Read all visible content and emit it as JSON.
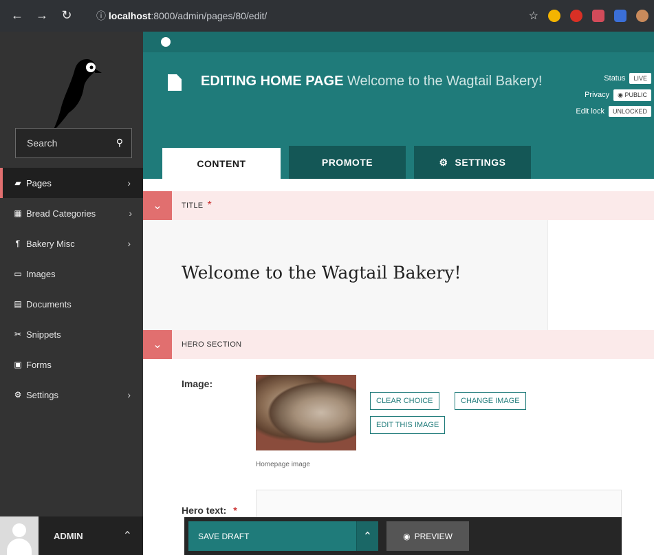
{
  "browser": {
    "url_host": "localhost",
    "url_path": ":8000/admin/pages/80/edit/"
  },
  "sidebar": {
    "search_placeholder": "Search",
    "items": [
      {
        "label": "Pages",
        "icon": "folder-icon",
        "has_submenu": true,
        "active": true
      },
      {
        "label": "Bread Categories",
        "icon": "briefcase-icon",
        "has_submenu": true
      },
      {
        "label": "Bakery Misc",
        "icon": "utensils-icon",
        "has_submenu": true
      },
      {
        "label": "Images",
        "icon": "image-icon",
        "has_submenu": false
      },
      {
        "label": "Documents",
        "icon": "document-icon",
        "has_submenu": false
      },
      {
        "label": "Snippets",
        "icon": "snippet-icon",
        "has_submenu": false
      },
      {
        "label": "Forms",
        "icon": "form-icon",
        "has_submenu": false
      },
      {
        "label": "Settings",
        "icon": "cogs-icon",
        "has_submenu": true
      }
    ],
    "account_name": "ADMIN"
  },
  "header": {
    "title_prefix": "EDITING HOME PAGE",
    "title_page": "Welcome to the Wagtail Bakery!",
    "status_label": "Status",
    "status_value": "LIVE",
    "privacy_label": "Privacy",
    "privacy_value": "PUBLIC",
    "edit_lock_label": "Edit lock",
    "edit_lock_value": "UNLOCKED"
  },
  "tabs": [
    {
      "label": "CONTENT",
      "active": true
    },
    {
      "label": "PROMOTE",
      "active": false
    },
    {
      "label": "SETTINGS",
      "active": false
    }
  ],
  "sections": {
    "title_section": "TITLE",
    "title_value": "Welcome to the Wagtail Bakery!",
    "hero_section": "HERO SECTION",
    "image_label": "Image:",
    "image_caption": "Homepage image",
    "clear_choice": "CLEAR CHOICE",
    "change_image": "CHANGE IMAGE",
    "edit_image": "EDIT THIS IMAGE",
    "hero_text_label": "Hero text:"
  },
  "actions": {
    "save_draft": "SAVE DRAFT",
    "preview": "PREVIEW"
  },
  "colors": {
    "teal": "#1f7b7a",
    "sidebar": "#333333",
    "accent": "#e16f6f"
  }
}
